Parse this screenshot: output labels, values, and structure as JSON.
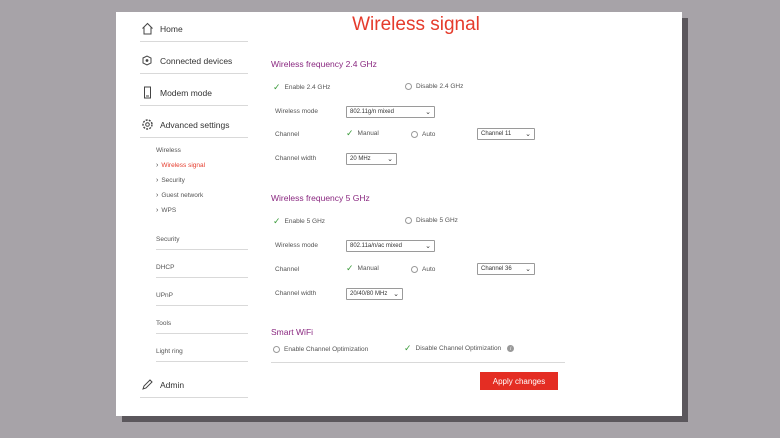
{
  "page": {
    "title": "Wireless signal"
  },
  "sidebar": {
    "home": "Home",
    "connected_devices": "Connected devices",
    "modem_mode": "Modem mode",
    "advanced_settings": "Advanced settings",
    "wireless": "Wireless",
    "wireless_items": [
      "Wireless signal",
      "Security",
      "Guest network",
      "WPS"
    ],
    "security": "Security",
    "dhcp": "DHCP",
    "upnp": "UPnP",
    "tools": "Tools",
    "light_ring": "Light ring",
    "admin": "Admin"
  },
  "freq24": {
    "title": "Wireless frequency 2.4 GHz",
    "enable": "Enable 2.4 GHz",
    "disable": "Disable 2.4 GHz",
    "mode_label": "Wireless mode",
    "mode_value": "802.11g/n mixed",
    "channel_label": "Channel",
    "manual": "Manual",
    "auto": "Auto",
    "channel_value": "Channel 11",
    "width_label": "Channel width",
    "width_value": "20 MHz"
  },
  "freq5": {
    "title": "Wireless frequency 5 GHz",
    "enable": "Enable 5 GHz",
    "disable": "Disable 5 GHz",
    "mode_label": "Wireless mode",
    "mode_value": "802.11a/n/ac mixed",
    "channel_label": "Channel",
    "manual": "Manual",
    "auto": "Auto",
    "channel_value": "Channel 36",
    "width_label": "Channel width",
    "width_value": "20/40/80 MHz"
  },
  "smart_wifi": {
    "title": "Smart WiFi",
    "enable": "Enable Channel Optimization",
    "disable": "Disable Channel Optimization"
  },
  "apply_label": "Apply changes",
  "colors": {
    "accent": "#e53b2c",
    "section": "#8a2880",
    "check": "#3a9a3a"
  }
}
